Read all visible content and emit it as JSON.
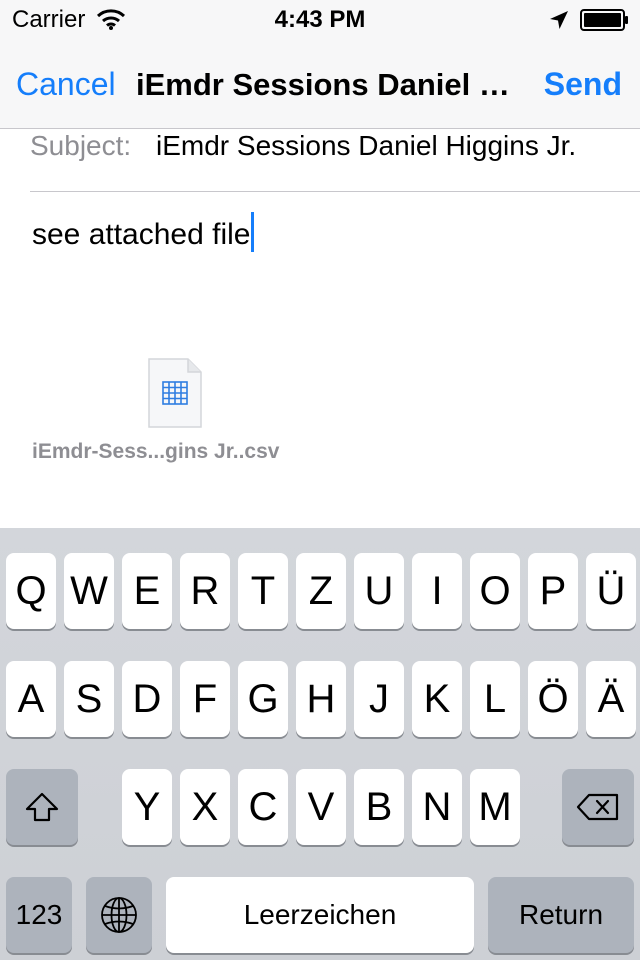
{
  "status_bar": {
    "carrier": "Carrier",
    "time": "4:43 PM"
  },
  "nav": {
    "cancel_label": "Cancel",
    "title": "iEmdr Sessions Daniel Higgins Jr.",
    "send_label": "Send"
  },
  "compose": {
    "subject_label": "Subject:",
    "subject_value": "iEmdr Sessions Daniel Higgins Jr.",
    "body_text": "see attached file",
    "attachment_name": "iEmdr-Sess...gins Jr..csv"
  },
  "keyboard": {
    "row1": [
      "Q",
      "W",
      "E",
      "R",
      "T",
      "Z",
      "U",
      "I",
      "O",
      "P",
      "Ü"
    ],
    "row2": [
      "A",
      "S",
      "D",
      "F",
      "G",
      "H",
      "J",
      "K",
      "L",
      "Ö",
      "Ä"
    ],
    "row3": [
      "Y",
      "X",
      "C",
      "V",
      "B",
      "N",
      "M"
    ],
    "numbers_label": "123",
    "space_label": "Leerzeichen",
    "return_label": "Return"
  },
  "colors": {
    "accent": "#157efb",
    "secondary_text": "#8e8e93",
    "keyboard_bg": "#d1d4d9",
    "function_key": "#adb3bc"
  },
  "icons": [
    "wifi-icon",
    "location-arrow-icon",
    "battery-icon",
    "spreadsheet-file-icon",
    "shift-icon",
    "backspace-icon",
    "globe-icon"
  ]
}
